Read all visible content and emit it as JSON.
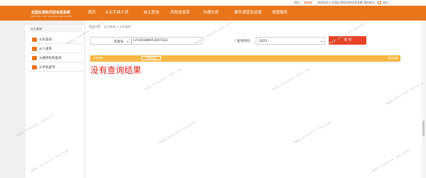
{
  "topbar": {
    "greeting": "您好，",
    "username": "李成成",
    "welcome": "欢迎您进入全国反侵权风控信息系统",
    "separator": "|",
    "login_link": "我的账号",
    "logout": "退出"
  },
  "brand": {
    "title": "全国反侵权风控信息系统",
    "subtitle": "NATIONAL ANTI-INFRINGE RISK SYSTEM"
  },
  "nav": [
    "首页",
    "从业手续人员",
    "自主查询",
    "风险信息库",
    "沟通交流",
    "案件调查及追偿",
    "增值服务"
  ],
  "sidebar": {
    "title": "自主查询",
    "items": [
      "从车查询",
      "从人查询",
      "从维修机构查询",
      "从手机查询"
    ]
  },
  "breadcrumb": "您的位置：  自主查询 > 从车查询",
  "form": {
    "type_select": "车架号",
    "vin_value": "LFV3A28K9F3007332",
    "time_label": "* 查询时间：",
    "year": "2023",
    "search_button": "查 询"
  },
  "result": {
    "bar_left": "从车查询",
    "tab": "查询结果",
    "bar_right": "导出结果",
    "empty_text": "没有查询结果"
  },
  "watermark": "李成成，XX-XX-XX-XX，2023-12-28",
  "colors": {
    "header": "#e8751a",
    "result_bar": "#f7b642",
    "search_button": "#e8442a",
    "empty_text": "#e0201a"
  }
}
